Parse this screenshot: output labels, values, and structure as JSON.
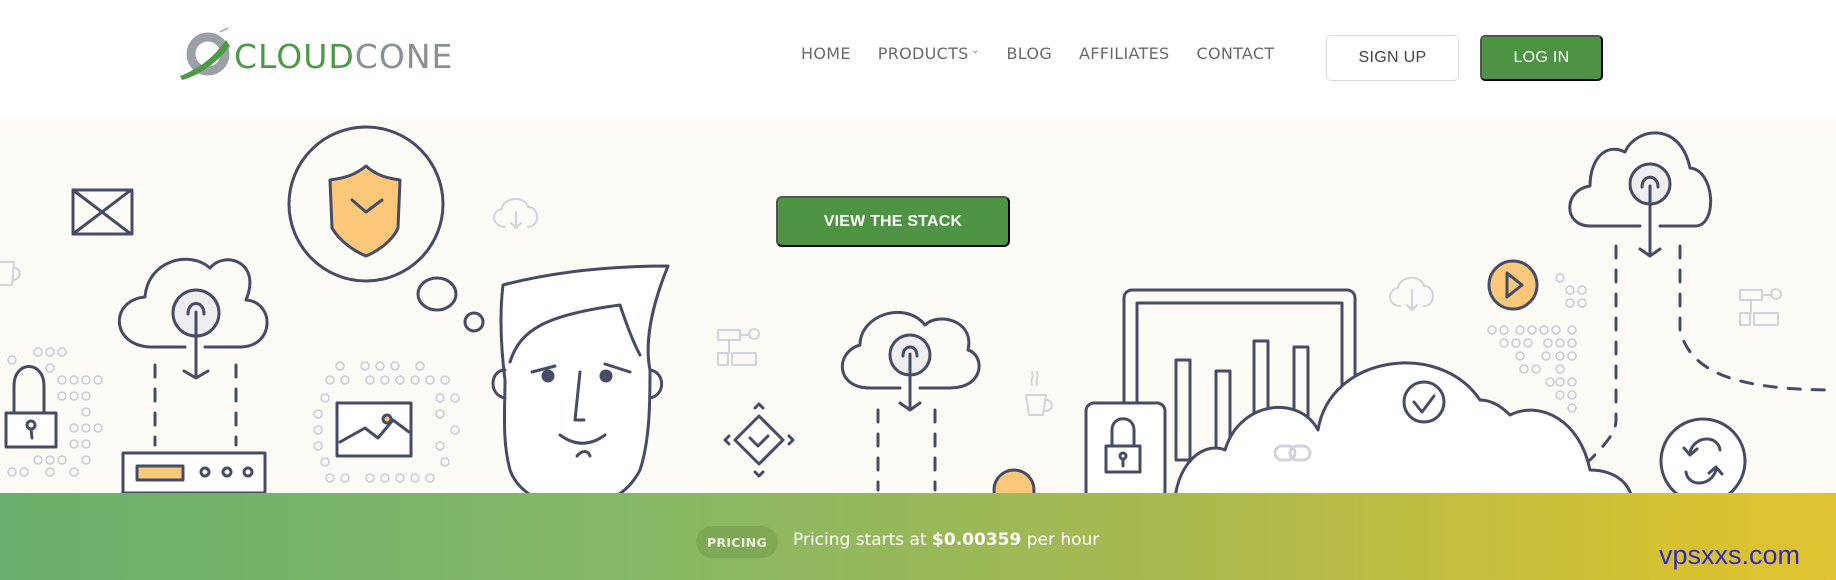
{
  "header": {
    "logo": {
      "part1": "CLOUD",
      "part2": "CONE",
      "icon": "cloudcone-swoosh-logo"
    },
    "nav": [
      {
        "label": "HOME"
      },
      {
        "label": "PRODUCTS",
        "has_dropdown": true,
        "dropdown_icon": "chevron-down-icon"
      },
      {
        "label": "BLOG"
      },
      {
        "label": "AFFILIATES"
      },
      {
        "label": "CONTACT"
      }
    ],
    "signup_label": "SIGN UP",
    "login_label": "LOG IN"
  },
  "hero": {
    "cta_label": "VIEW THE STACK",
    "illustration_icons": [
      "envelope-icon",
      "shield-check-icon",
      "cloud-download-icon",
      "padlock-icon",
      "server-icon",
      "image-icon",
      "person-illustration",
      "flowchart-icon",
      "diamond-check-icon",
      "coffee-cup-icon",
      "monitor-chart-icon",
      "cloud-check-icon",
      "link-icon",
      "play-icon",
      "sync-icon"
    ]
  },
  "pricing": {
    "badge": "PRICING",
    "text_before": "Pricing starts at ",
    "price": "$0.00359",
    "text_after": " per hour"
  },
  "watermark": "vpsxxs.com",
  "colors": {
    "brand_green": "#4e9344",
    "logo_gray": "#8a8f96",
    "hero_bg": "#fdfbf6",
    "illustration_stroke": "#464c66",
    "illustration_accent": "#fbc87a",
    "gradient_start": "#6aaf6d",
    "gradient_end": "#e0c431",
    "watermark": "#3127c6"
  }
}
